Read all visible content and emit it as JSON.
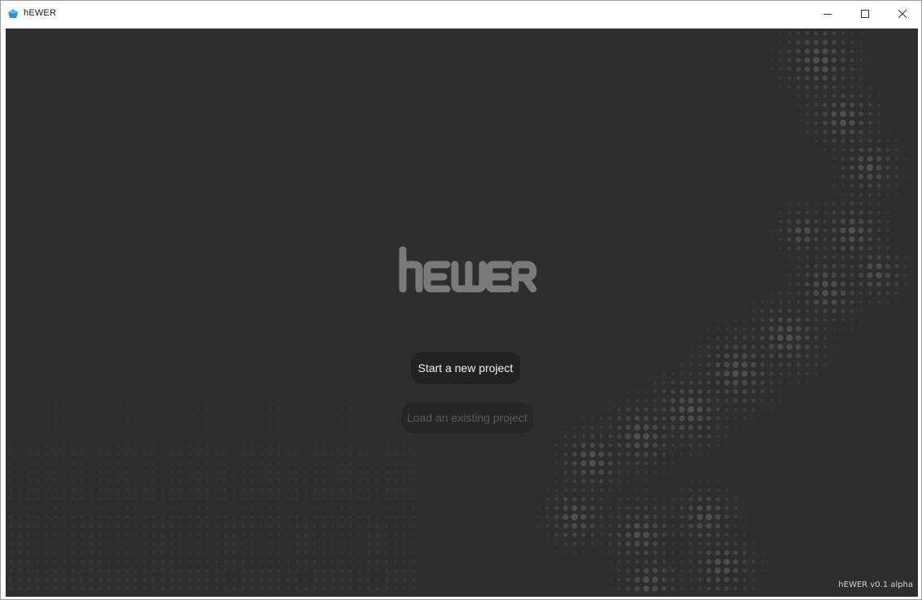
{
  "window": {
    "title": "hEWER",
    "controls": {
      "minimize_icon": "minimize-icon",
      "maximize_icon": "maximize-icon",
      "close_icon": "close-icon"
    }
  },
  "main": {
    "logo_text": "hEWER",
    "primary_button_label": "Start a new project",
    "secondary_button_label": "Load an existing project",
    "secondary_button_state": "disabled",
    "version_text": "hEWER v0.1 alpha"
  },
  "colors": {
    "background": "#2e2e2e",
    "logo": "#7a7a7a",
    "button_bg": "#222222",
    "button_text": "#f2f2f2",
    "disabled_text": "#5a5a5a",
    "app_icon": "#2b8fd6"
  }
}
